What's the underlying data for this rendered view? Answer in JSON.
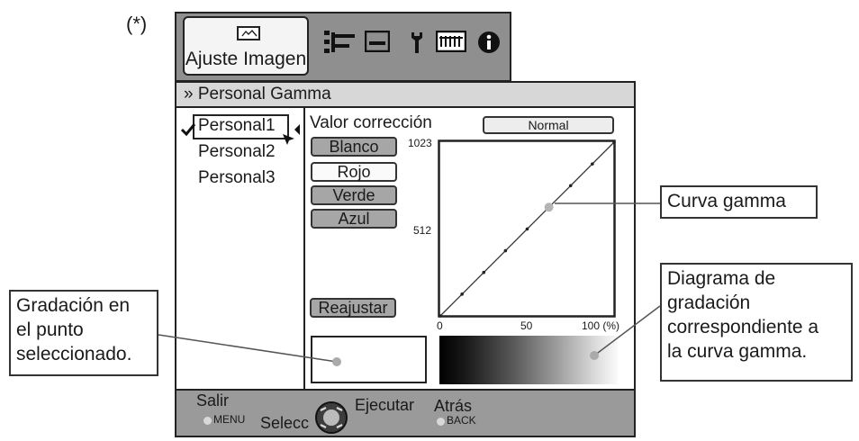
{
  "footnote_mark": "(*)",
  "top_tabs": {
    "active_label": "Ajuste Imagen"
  },
  "header": {
    "title": "» Personal Gamma"
  },
  "presets": [
    {
      "label": "Personal1",
      "checked": true,
      "selected": true
    },
    {
      "label": "Personal2",
      "checked": false,
      "selected": false
    },
    {
      "label": "Personal3",
      "checked": false,
      "selected": false
    }
  ],
  "correction": {
    "label": "Valor corrección",
    "value": "Normal",
    "channels": [
      {
        "label": "Blanco",
        "active": true
      },
      {
        "label": "Rojo",
        "active": false
      },
      {
        "label": "Verde",
        "active": true
      },
      {
        "label": "Azul",
        "active": true
      }
    ],
    "reset_label": "Reajustar"
  },
  "chart_data": {
    "type": "line",
    "x": [
      0,
      12.5,
      25,
      37.5,
      50,
      62.5,
      75,
      87.5,
      100
    ],
    "series": [
      {
        "values": [
          0,
          128,
          256,
          384,
          512,
          640,
          767,
          895,
          1023
        ]
      }
    ],
    "selected_point": {
      "x": 62.5,
      "y": 640
    },
    "y_ticks": [
      "1023",
      "512"
    ],
    "x_ticks": [
      "0",
      "50",
      "100 (%)"
    ],
    "xlim": [
      0,
      100
    ],
    "ylim": [
      0,
      1023
    ]
  },
  "footer": {
    "exit_label": "Salir",
    "exit_key": "MENU",
    "select_label": "Selecc",
    "execute_label": "Ejecutar",
    "back_label": "Atrás",
    "back_key": "BACK"
  },
  "callouts": {
    "gamma_curve": "Curva gamma",
    "gradation_diagram": [
      "Diagrama de",
      "gradación",
      "correspondiente a",
      "la curva gamma."
    ],
    "point_gradation": [
      "Gradación en",
      "el punto",
      "seleccionado."
    ]
  }
}
